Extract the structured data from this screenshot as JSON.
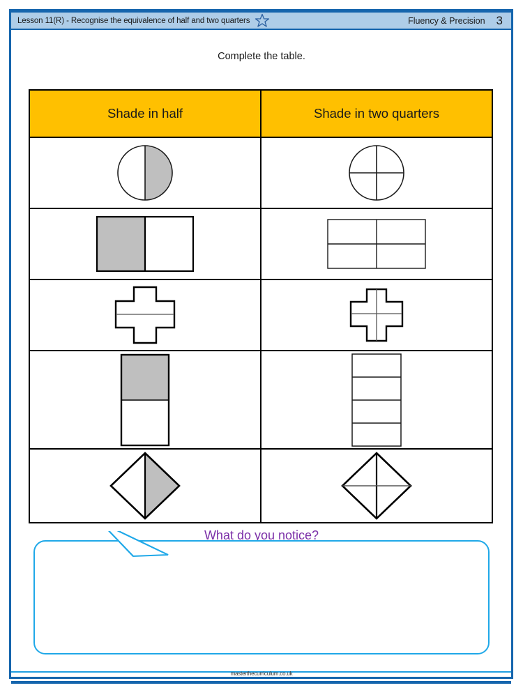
{
  "header": {
    "lesson_title": "Lesson 11(R) - Recognise the equivalence of half and two quarters",
    "star_icon": "star-outline-icon",
    "strand": "Fluency & Precision",
    "page_number": "3",
    "band_color": "#aecde8",
    "border_color": "#1565ad"
  },
  "instruction": "Complete the table.",
  "table": {
    "headers": [
      "Shade in half",
      "Shade in two quarters"
    ],
    "header_bg": "#ffc000",
    "shade_color": "#bfbfbf",
    "line_color": "#000000",
    "rows": [
      {
        "left": {
          "shape": "circle",
          "partition": "half-vertical",
          "shaded": "right-half"
        },
        "right": {
          "shape": "circle",
          "partition": "quarters-cross",
          "shaded": "none"
        }
      },
      {
        "left": {
          "shape": "rectangle-wide",
          "partition": "half-vertical",
          "shaded": "left-half"
        },
        "right": {
          "shape": "rectangle-wide",
          "partition": "quarters-grid",
          "shaded": "none"
        }
      },
      {
        "left": {
          "shape": "cross",
          "partition": "half-horizontal",
          "shaded": "none"
        },
        "right": {
          "shape": "cross",
          "partition": "quarters-cross",
          "shaded": "none"
        }
      },
      {
        "left": {
          "shape": "rectangle-tall",
          "partition": "half-horizontal",
          "shaded": "top-half"
        },
        "right": {
          "shape": "rectangle-tall",
          "partition": "quarters-bands",
          "shaded": "none"
        }
      },
      {
        "left": {
          "shape": "diamond",
          "partition": "half-vertical",
          "shaded": "right-half"
        },
        "right": {
          "shape": "diamond",
          "partition": "quarters-cross",
          "shaded": "none"
        }
      }
    ]
  },
  "notice": {
    "prompt": "What do you notice?",
    "prompt_color": "#7b2fa8",
    "bubble_color": "#1fa8e8",
    "answer": ""
  },
  "footer": {
    "credit": "masterthecurriculum.co.uk",
    "rule_color": "#1f9ee0"
  }
}
